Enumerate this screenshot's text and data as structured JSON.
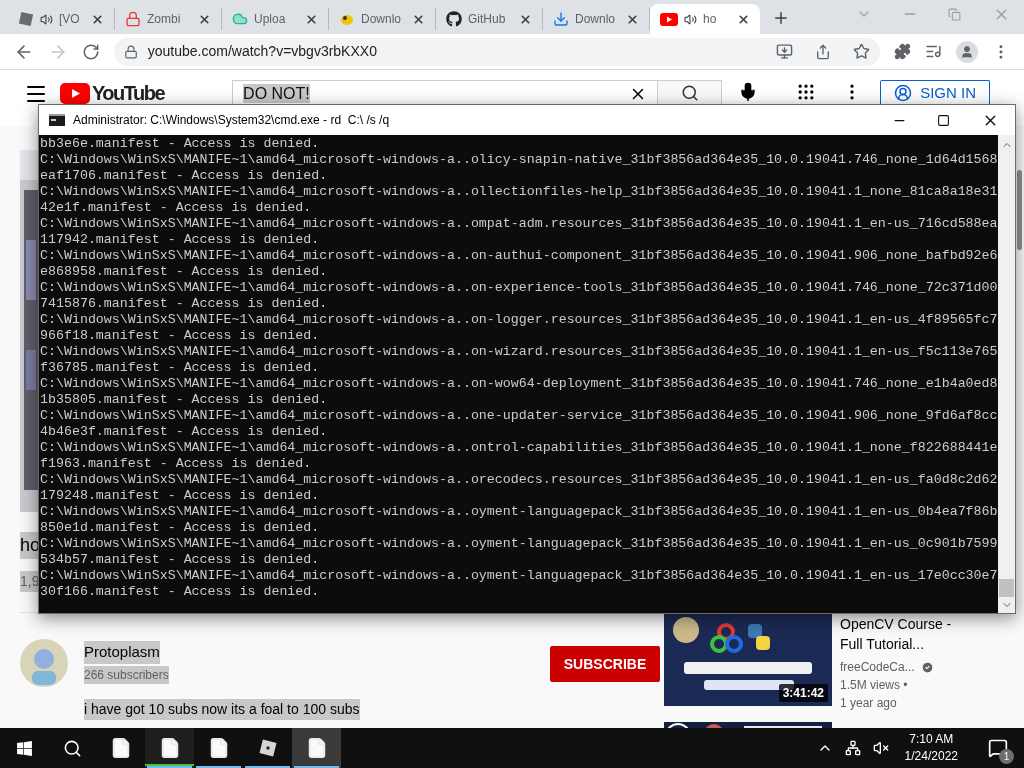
{
  "browser": {
    "tabs": [
      {
        "title": "[VO",
        "kind": "roblox",
        "audio": true,
        "selected": false
      },
      {
        "title": "Zombi",
        "kind": "lock",
        "audio": false,
        "selected": false
      },
      {
        "title": "Uploa",
        "kind": "cloud",
        "audio": false,
        "selected": false
      },
      {
        "title": "Downlo",
        "kind": "bird",
        "audio": false,
        "selected": false
      },
      {
        "title": "GitHub",
        "kind": "github",
        "audio": false,
        "selected": false
      },
      {
        "title": "Downlo",
        "kind": "download",
        "audio": false,
        "selected": false
      },
      {
        "title": "ho",
        "kind": "youtube",
        "audio": true,
        "selected": true
      }
    ],
    "address": {
      "url": "youtube.com/watch?v=vbgv3rbKXX0",
      "forward_disabled": true
    }
  },
  "youtube": {
    "logo": "YouTube",
    "search": {
      "value": "DO NOT!"
    },
    "sign_in": "SIGN IN",
    "video": {
      "title": "ho",
      "views": "1,9"
    },
    "channel": {
      "name": "Protoplasm",
      "subscribers": "266 subscribers",
      "subscribe": "SUBSCRIBE"
    },
    "description": "i have got 10 subs now its a foal to 100 subs",
    "related": [
      {
        "kind": "full",
        "title": "OpenCV Course - Full Tutorial...",
        "channel": "freeCodeCa...",
        "verified": true,
        "views": "1.5M views •",
        "age": "1 year ago",
        "duration": "3:41:42"
      },
      {
        "kind": "partial"
      }
    ]
  },
  "cmd": {
    "title": "Administrator: C:\\Windows\\System32\\cmd.exe - rd  C:\\ /s /q",
    "lines": [
      "bb3e6e.manifest - Access is denied.",
      "C:\\Windows\\WinSxS\\MANIFE~1\\amd64_microsoft-windows-a..olicy-snapin-native_31bf3856ad364e35_10.0.19041.746_none_1d64d1568",
      "eaf1706.manifest - Access is denied.",
      "C:\\Windows\\WinSxS\\MANIFE~1\\amd64_microsoft-windows-a..ollectionfiles-help_31bf3856ad364e35_10.0.19041.1_none_81ca8a18e31",
      "42e1f.manifest - Access is denied.",
      "C:\\Windows\\WinSxS\\MANIFE~1\\amd64_microsoft-windows-a..ompat-adm.resources_31bf3856ad364e35_10.0.19041.1_en-us_716cd588ea",
      "117942.manifest - Access is denied.",
      "C:\\Windows\\WinSxS\\MANIFE~1\\amd64_microsoft-windows-a..on-authui-component_31bf3856ad364e35_10.0.19041.906_none_bafbd92e6",
      "e868958.manifest - Access is denied.",
      "C:\\Windows\\WinSxS\\MANIFE~1\\amd64_microsoft-windows-a..on-experience-tools_31bf3856ad364e35_10.0.19041.746_none_72c371d00",
      "7415876.manifest - Access is denied.",
      "C:\\Windows\\WinSxS\\MANIFE~1\\amd64_microsoft-windows-a..on-logger.resources_31bf3856ad364e35_10.0.19041.1_en-us_4f89565fc7",
      "966f18.manifest - Access is denied.",
      "C:\\Windows\\WinSxS\\MANIFE~1\\amd64_microsoft-windows-a..on-wizard.resources_31bf3856ad364e35_10.0.19041.1_en-us_f5c113e765",
      "f36785.manifest - Access is denied.",
      "C:\\Windows\\WinSxS\\MANIFE~1\\amd64_microsoft-windows-a..on-wow64-deployment_31bf3856ad364e35_10.0.19041.746_none_e1b4a0ed8",
      "1b35805.manifest - Access is denied.",
      "C:\\Windows\\WinSxS\\MANIFE~1\\amd64_microsoft-windows-a..one-updater-service_31bf3856ad364e35_10.0.19041.906_none_9fd6af8cc",
      "4b46e3f.manifest - Access is denied.",
      "C:\\Windows\\WinSxS\\MANIFE~1\\amd64_microsoft-windows-a..ontrol-capabilities_31bf3856ad364e35_10.0.19041.1_none_f822688441e",
      "f1963.manifest - Access is denied.",
      "C:\\Windows\\WinSxS\\MANIFE~1\\amd64_microsoft-windows-a..orecodecs.resources_31bf3856ad364e35_10.0.19041.1_en-us_fa0d8c2d62",
      "179248.manifest - Access is denied.",
      "C:\\Windows\\WinSxS\\MANIFE~1\\amd64_microsoft-windows-a..oyment-languagepack_31bf3856ad364e35_10.0.19041.1_en-us_0b4ea7f86b",
      "850e1d.manifest - Access is denied.",
      "C:\\Windows\\WinSxS\\MANIFE~1\\amd64_microsoft-windows-a..oyment-languagepack_31bf3856ad364e35_10.0.19041.1_en-us_0c901b7599",
      "534b57.manifest - Access is denied.",
      "C:\\Windows\\WinSxS\\MANIFE~1\\amd64_microsoft-windows-a..oyment-languagepack_31bf3856ad364e35_10.0.19041.1_en-us_17e0cc30e7",
      "30f166.manifest - Access is denied."
    ]
  },
  "taskbar": {
    "items": [
      {
        "kind": "file",
        "open": false,
        "focused": false
      },
      {
        "kind": "file",
        "open": true,
        "focused": false,
        "level": 1
      },
      {
        "kind": "file",
        "open": true,
        "focused": false
      },
      {
        "kind": "roblox",
        "open": true,
        "focused": false
      },
      {
        "kind": "file",
        "open": true,
        "focused": true
      }
    ],
    "time": "7:10 AM",
    "date": "1/24/2022",
    "notifications": "1"
  }
}
